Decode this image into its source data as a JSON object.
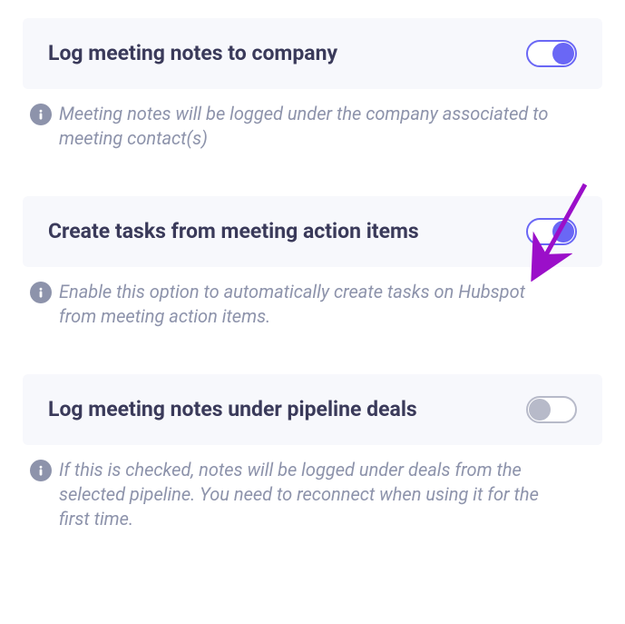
{
  "settings": [
    {
      "id": "log-company",
      "title": "Log meeting notes to company",
      "description": "Meeting notes will be logged under the company associated to meeting contact(s)",
      "enabled": true,
      "highlighted": false
    },
    {
      "id": "create-tasks",
      "title": "Create tasks from meeting action items",
      "description": "Enable this option to automatically create tasks on Hubspot from meeting action items.",
      "enabled": true,
      "highlighted": true
    },
    {
      "id": "log-pipeline",
      "title": "Log meeting notes under pipeline deals",
      "description": "If this is checked, notes will be logged under deals from the selected pipeline. You need to reconnect when using it for the first time.",
      "enabled": false,
      "highlighted": false
    }
  ],
  "colors": {
    "accent": "#6a67f5",
    "muted": "#8d93ab",
    "arrow": "#9b0fc9"
  }
}
